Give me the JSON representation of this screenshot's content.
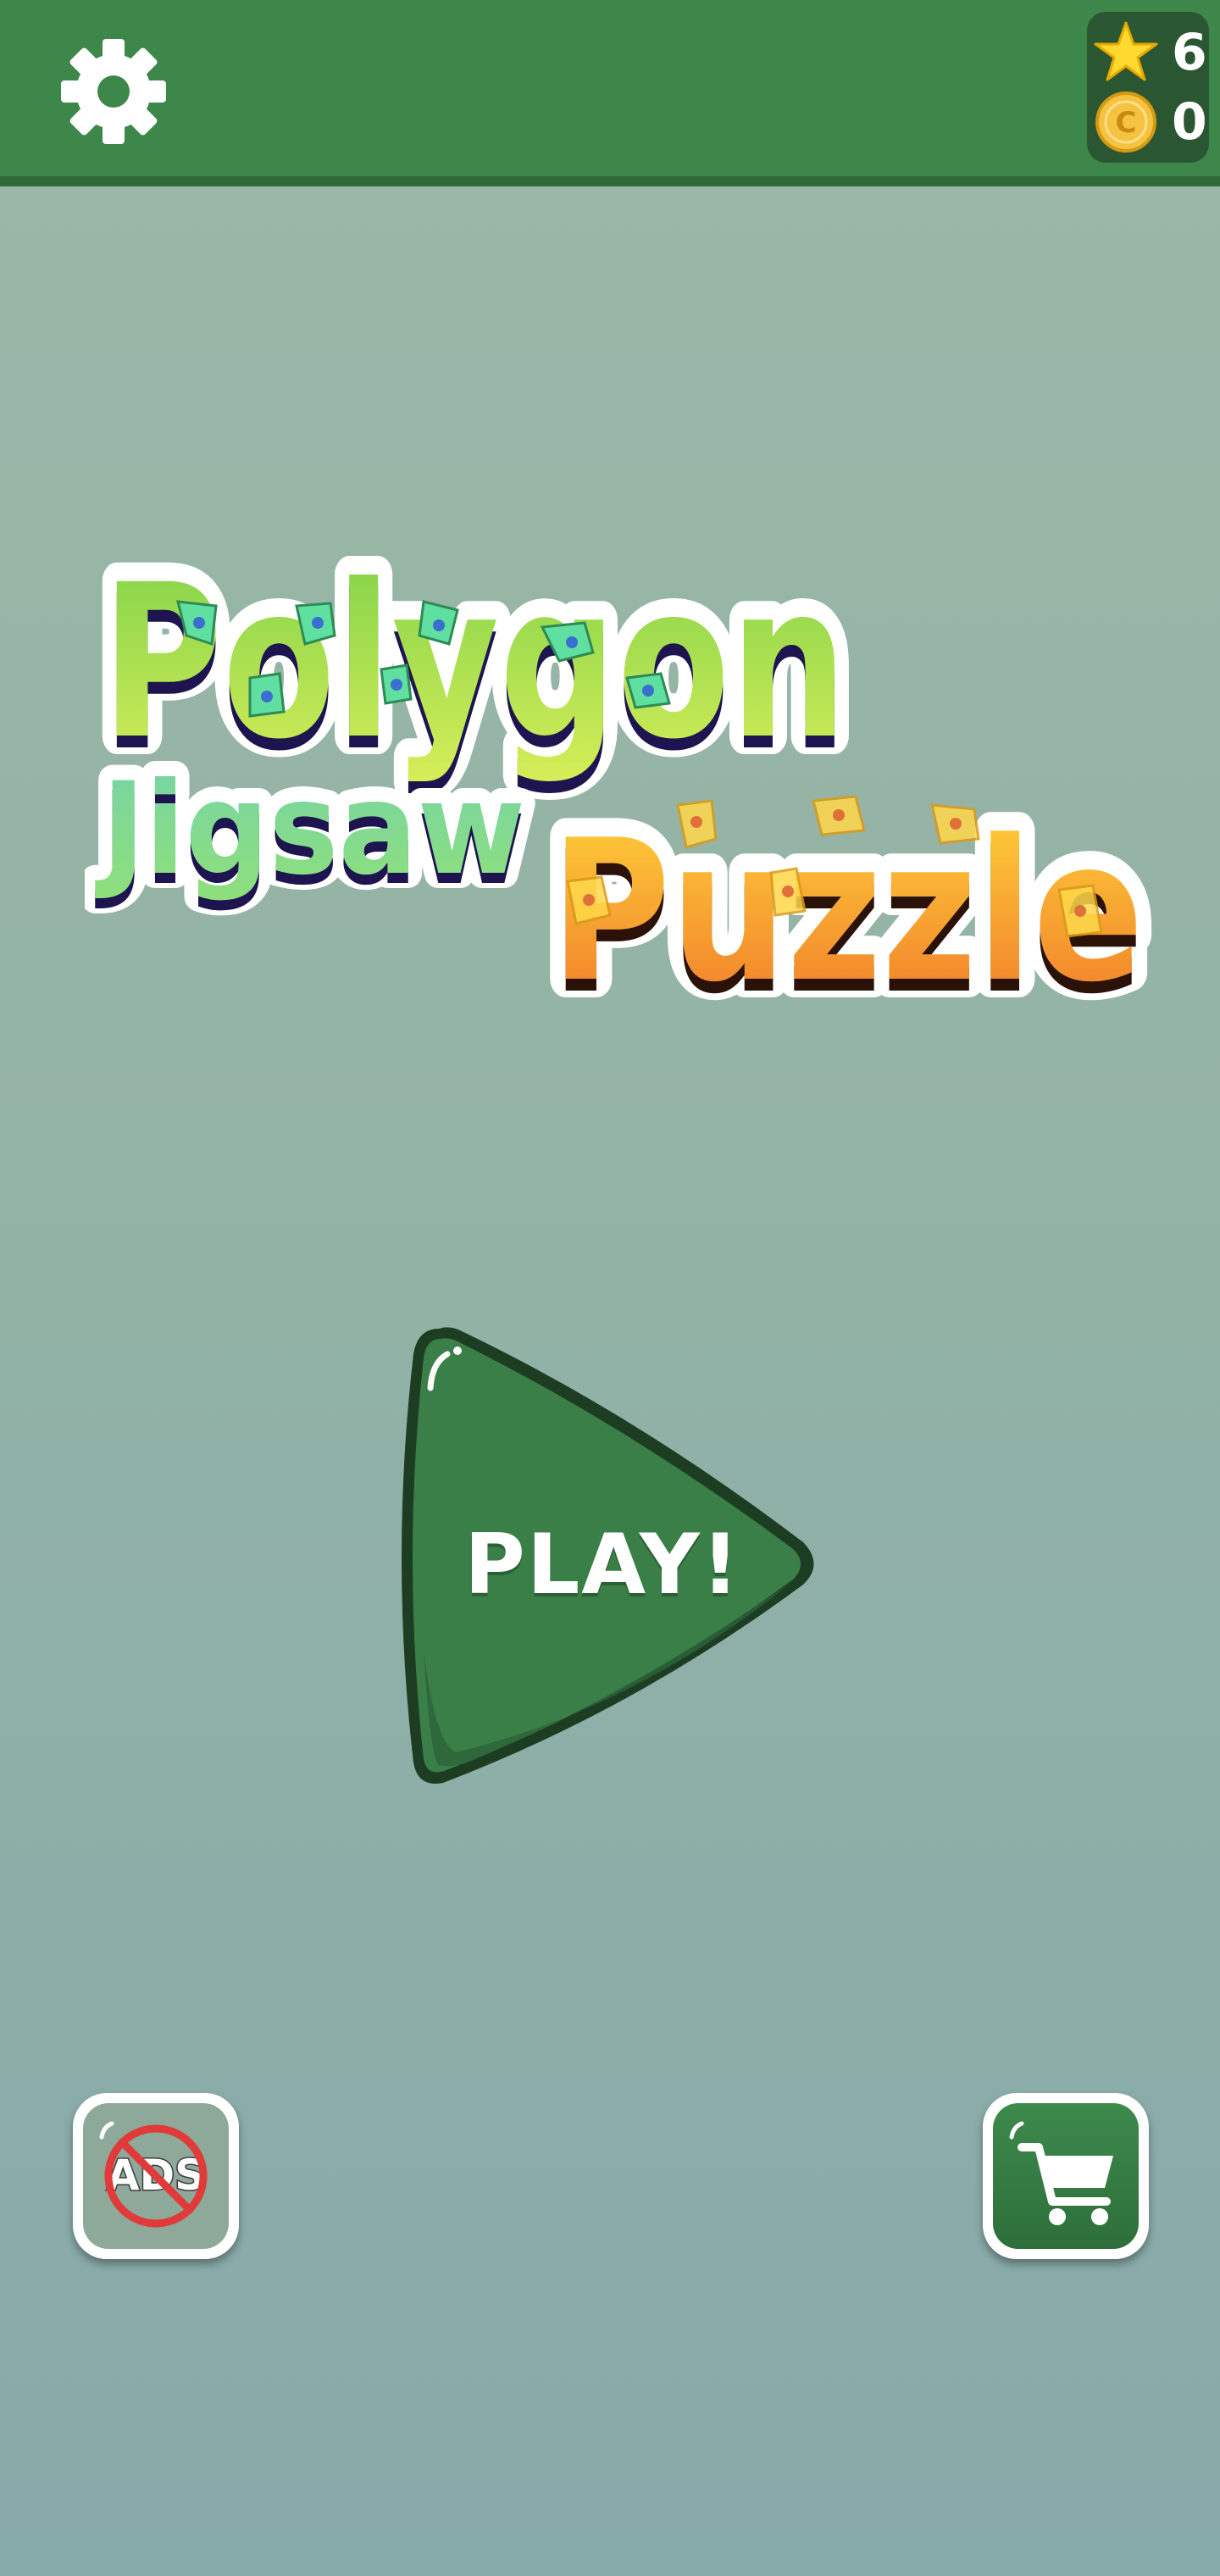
{
  "topbar": {
    "settings_icon": "gear-icon",
    "stars": {
      "icon": "star-icon",
      "value": "6"
    },
    "coins": {
      "icon": "coin-icon",
      "coin_letter": "C",
      "value": "0"
    }
  },
  "logo": {
    "line1": "Polygon",
    "line2": "Jigsaw",
    "line3": "Puzzle"
  },
  "play": {
    "label": "PLAY!"
  },
  "no_ads": {
    "icon": "no-ads-icon",
    "label": "ADS"
  },
  "shop": {
    "icon": "shopping-cart-icon"
  },
  "colors": {
    "topbar": "#3e874b",
    "panel": "#2a5632",
    "play_button": "#3a7f47",
    "logo_green": "#8fd13a",
    "logo_orange": "#f39a2a"
  }
}
